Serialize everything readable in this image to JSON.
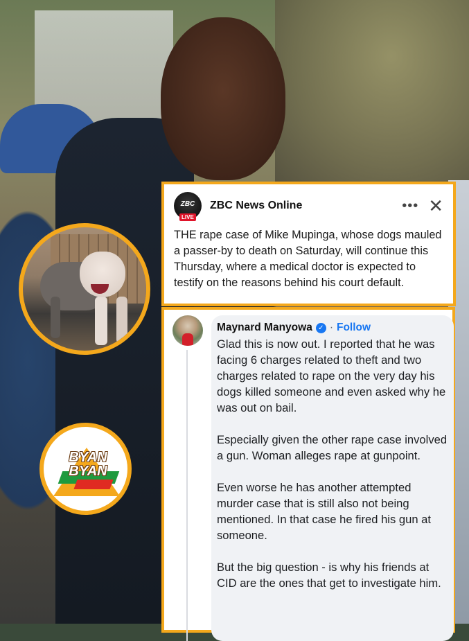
{
  "post": {
    "page_name": "ZBC News Online",
    "logo_text": "ZBC",
    "live_badge": "LIVE",
    "more_glyph": "•••",
    "close_glyph": "✕",
    "body": "THE rape case of Mike Mupinga, whose dogs mauled a passer-by to death on Saturday, will continue this Thursday, where a medical doctor is expected to testify on the reasons behind his court default."
  },
  "comment": {
    "author": "Maynard Manyowa",
    "verified_glyph": "✓",
    "separator": "·",
    "follow_label": "Follow",
    "paragraphs": [
      "Glad this is now out. I reported that he was facing 6 charges related to theft and two charges related to rape on the very day his dogs killed someone and even asked why he was out on bail.",
      "Especially given the other rape case involved a gun. Woman alleges rape at gunpoint.",
      "Even worse he has another attempted murder case that is still also not being mentioned. In that case he fired his gun at someone.",
      "But the big question - is why his friends at CID are the ones that get to investigate him."
    ]
  },
  "watermark": {
    "line1": "BYAN",
    "line2": "BYAN"
  },
  "colors": {
    "accent": "#f4a81c",
    "facebook_blue": "#1877f2",
    "live_red": "#e0142a"
  },
  "icons": [
    "more-options-icon",
    "close-icon",
    "verified-badge-icon"
  ]
}
